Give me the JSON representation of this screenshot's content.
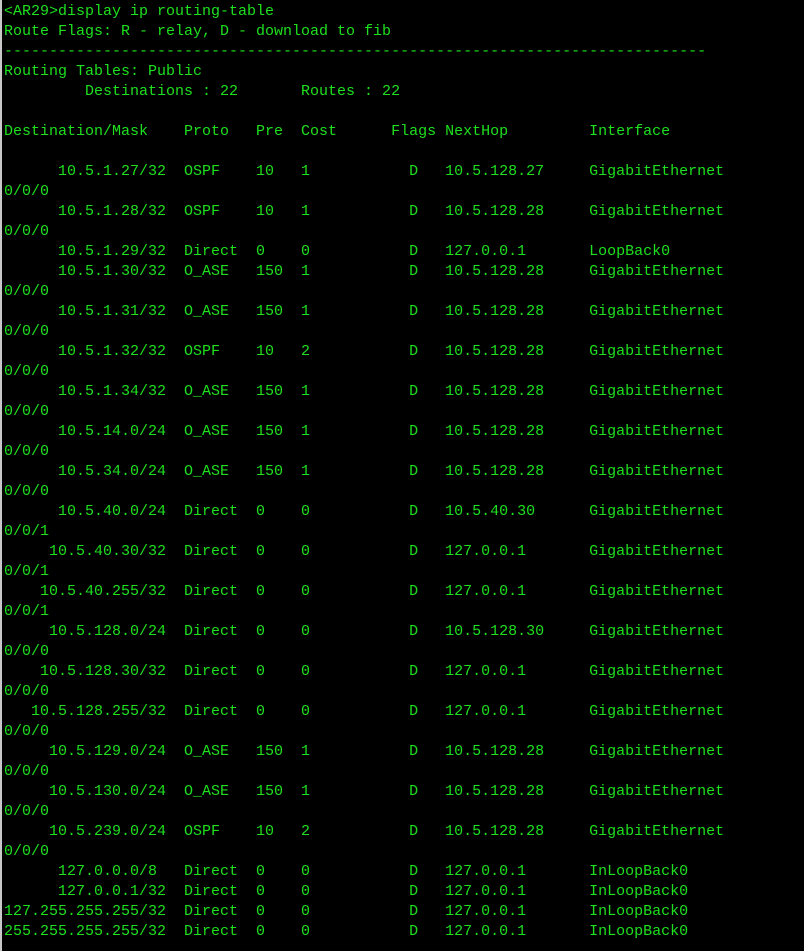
{
  "theme": {
    "background": "#000000",
    "text_color": "#1ee01e"
  },
  "terminal": {
    "lines": [
      "<AR29>display ip routing-table",
      "Route Flags: R - relay, D - download to fib",
      "------------------------------------------------------------------------------",
      "Routing Tables: Public",
      "         Destinations : 22       Routes : 22",
      "",
      "Destination/Mask    Proto   Pre  Cost      Flags NextHop         Interface",
      "",
      "      10.5.1.27/32  OSPF    10   1           D   10.5.128.27     GigabitEthernet",
      "0/0/0",
      "      10.5.1.28/32  OSPF    10   1           D   10.5.128.28     GigabitEthernet",
      "0/0/0",
      "      10.5.1.29/32  Direct  0    0           D   127.0.0.1       LoopBack0",
      "      10.5.1.30/32  O_ASE   150  1           D   10.5.128.28     GigabitEthernet",
      "0/0/0",
      "      10.5.1.31/32  O_ASE   150  1           D   10.5.128.28     GigabitEthernet",
      "0/0/0",
      "      10.5.1.32/32  OSPF    10   2           D   10.5.128.28     GigabitEthernet",
      "0/0/0",
      "      10.5.1.34/32  O_ASE   150  1           D   10.5.128.28     GigabitEthernet",
      "0/0/0",
      "      10.5.14.0/24  O_ASE   150  1           D   10.5.128.28     GigabitEthernet",
      "0/0/0",
      "      10.5.34.0/24  O_ASE   150  1           D   10.5.128.28     GigabitEthernet",
      "0/0/0",
      "      10.5.40.0/24  Direct  0    0           D   10.5.40.30      GigabitEthernet",
      "0/0/1",
      "     10.5.40.30/32  Direct  0    0           D   127.0.0.1       GigabitEthernet",
      "0/0/1",
      "    10.5.40.255/32  Direct  0    0           D   127.0.0.1       GigabitEthernet",
      "0/0/1",
      "     10.5.128.0/24  Direct  0    0           D   10.5.128.30     GigabitEthernet",
      "0/0/0",
      "    10.5.128.30/32  Direct  0    0           D   127.0.0.1       GigabitEthernet",
      "0/0/0",
      "   10.5.128.255/32  Direct  0    0           D   127.0.0.1       GigabitEthernet",
      "0/0/0",
      "     10.5.129.0/24  O_ASE   150  1           D   10.5.128.28     GigabitEthernet",
      "0/0/0",
      "     10.5.130.0/24  O_ASE   150  1           D   10.5.128.28     GigabitEthernet",
      "0/0/0",
      "     10.5.239.0/24  OSPF    10   2           D   10.5.128.28     GigabitEthernet",
      "0/0/0",
      "      127.0.0.0/8   Direct  0    0           D   127.0.0.1       InLoopBack0",
      "      127.0.0.1/32  Direct  0    0           D   127.0.0.1       InLoopBack0",
      "127.255.255.255/32  Direct  0    0           D   127.0.0.1       InLoopBack0",
      "255.255.255.255/32  Direct  0    0           D   127.0.0.1       InLoopBack0"
    ]
  }
}
